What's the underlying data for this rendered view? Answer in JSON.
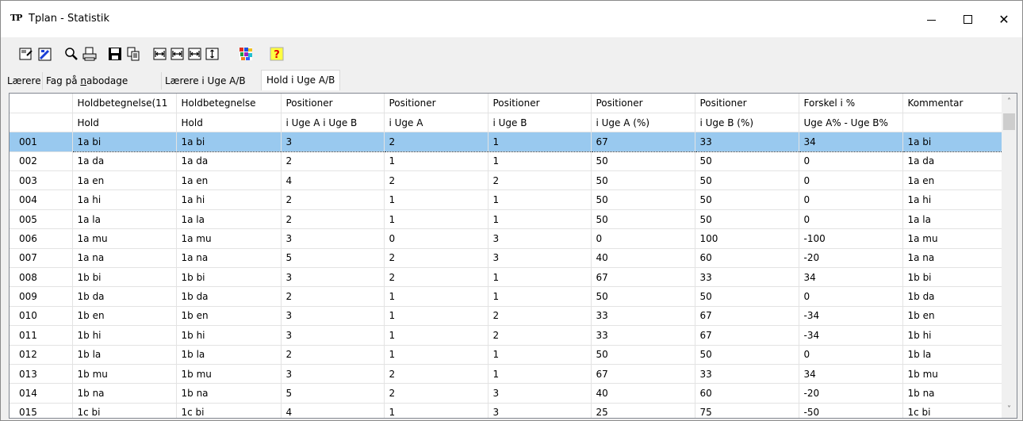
{
  "window": {
    "logo_text": "TP",
    "title": "Tplan - Statistik",
    "minimize_icon": "minimize-icon",
    "maximize_icon": "maximize-icon",
    "close_glyph": "✕"
  },
  "toolbar": {
    "buttons": [
      {
        "icon": "properties-icon"
      },
      {
        "icon": "edit-sheet-icon"
      },
      {
        "icon": "search-icon"
      },
      {
        "icon": "print-icon"
      },
      {
        "icon": "save-icon"
      },
      {
        "icon": "copy-icon"
      },
      {
        "icon": "column-width-icon-1"
      },
      {
        "icon": "column-width-icon-2"
      },
      {
        "icon": "column-width-icon-3"
      },
      {
        "icon": "row-height-icon"
      },
      {
        "icon": "colors-icon"
      },
      {
        "icon": "help-icon"
      }
    ]
  },
  "tabs": [
    {
      "label": "Lærere",
      "active": false
    },
    {
      "label_pre": "Fag på ",
      "label_u": "n",
      "label_post": "abodage",
      "active": false
    },
    {
      "label": "Lærere i Uge A/B",
      "active": false
    },
    {
      "label": "Hold i Uge A/B",
      "active": true
    }
  ],
  "grid": {
    "header_row1": [
      "",
      "Holdbetegnelse(11",
      "Holdbetegnelse",
      "Positioner",
      "Positioner",
      "Positioner",
      "Positioner",
      "Positioner",
      "Forskel i %",
      "Kommentar"
    ],
    "header_row2": [
      "",
      "Hold",
      "Hold",
      "i Uge A i Uge B",
      "i Uge A",
      "i Uge B",
      "i Uge A (%)",
      "i Uge B (%)",
      "Uge A% - Uge B%",
      ""
    ],
    "selected_row": 0,
    "rows": [
      [
        "001",
        "1a bi",
        "1a bi",
        "3",
        "2",
        "1",
        "67",
        "33",
        "34",
        "1a bi"
      ],
      [
        "002",
        "1a da",
        "1a da",
        "2",
        "1",
        "1",
        "50",
        "50",
        "0",
        "1a da"
      ],
      [
        "003",
        "1a en",
        "1a en",
        "4",
        "2",
        "2",
        "50",
        "50",
        "0",
        "1a en"
      ],
      [
        "004",
        "1a hi",
        "1a hi",
        "2",
        "1",
        "1",
        "50",
        "50",
        "0",
        "1a hi"
      ],
      [
        "005",
        "1a la",
        "1a la",
        "2",
        "1",
        "1",
        "50",
        "50",
        "0",
        "1a la"
      ],
      [
        "006",
        "1a mu",
        "1a mu",
        "3",
        "0",
        "3",
        "0",
        "100",
        "-100",
        "1a mu"
      ],
      [
        "007",
        "1a na",
        "1a na",
        "5",
        "2",
        "3",
        "40",
        "60",
        "-20",
        "1a na"
      ],
      [
        "008",
        "1b bi",
        "1b bi",
        "3",
        "2",
        "1",
        "67",
        "33",
        "34",
        "1b bi"
      ],
      [
        "009",
        "1b da",
        "1b da",
        "2",
        "1",
        "1",
        "50",
        "50",
        "0",
        "1b da"
      ],
      [
        "010",
        "1b en",
        "1b en",
        "3",
        "1",
        "2",
        "33",
        "67",
        "-34",
        "1b en"
      ],
      [
        "011",
        "1b hi",
        "1b hi",
        "3",
        "1",
        "2",
        "33",
        "67",
        "-34",
        "1b hi"
      ],
      [
        "012",
        "1b la",
        "1b la",
        "2",
        "1",
        "1",
        "50",
        "50",
        "0",
        "1b la"
      ],
      [
        "013",
        "1b mu",
        "1b mu",
        "3",
        "2",
        "1",
        "67",
        "33",
        "34",
        "1b mu"
      ],
      [
        "014",
        "1b na",
        "1b na",
        "5",
        "2",
        "3",
        "40",
        "60",
        "-20",
        "1b na"
      ],
      [
        "015",
        "1c bi",
        "1c bi",
        "4",
        "1",
        "3",
        "25",
        "75",
        "-50",
        "1c bi"
      ]
    ]
  },
  "scrollbar": {
    "up_glyph": "˄",
    "down_glyph": "˅"
  }
}
